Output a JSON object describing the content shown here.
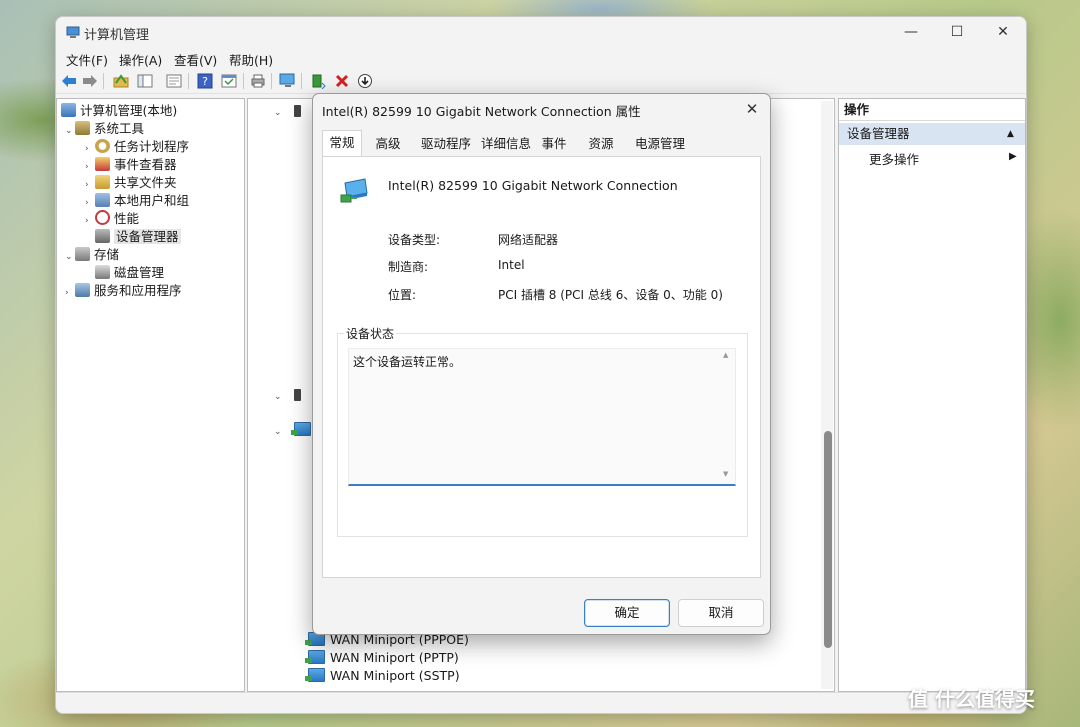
{
  "window": {
    "title": "计算机管理",
    "minimize": "—",
    "maximize": "☐",
    "close": "✕"
  },
  "menu": [
    "文件(F)",
    "操作(A)",
    "查看(V)",
    "帮助(H)"
  ],
  "toolbar": {
    "icons": [
      "back-icon",
      "forward-icon",
      "up-folder-icon",
      "console-tree-icon",
      "export-icon",
      "help-icon",
      "properties-icon",
      "print-icon",
      "scan-hardware-icon",
      "update-driver-icon",
      "uninstall-icon",
      "disable-icon"
    ]
  },
  "tree": {
    "root": "计算机管理(本地)",
    "system_tools": "系统工具",
    "task_scheduler": "任务计划程序",
    "event_viewer": "事件查看器",
    "shared_folders": "共享文件夹",
    "local_users": "本地用户和组",
    "performance": "性能",
    "device_manager": "设备管理器",
    "storage": "存储",
    "disk_management": "磁盘管理",
    "services_apps": "服务和应用程序"
  },
  "devices": {
    "visible": [
      "WAN Miniport (PPPOE)",
      "WAN Miniport (PPTP)",
      "WAN Miniport (SSTP)"
    ]
  },
  "actions": {
    "header": "操作",
    "section": "设备管理器",
    "more": "更多操作"
  },
  "dialog": {
    "title": "Intel(R) 82599 10 Gigabit Network Connection 属性",
    "close": "✕",
    "tabs": [
      "常规",
      "高级",
      "驱动程序",
      "详细信息",
      "事件",
      "资源",
      "电源管理"
    ],
    "device_name": "Intel(R) 82599 10 Gigabit Network Connection",
    "device_type_label": "设备类型:",
    "device_type_value": "网络适配器",
    "manufacturer_label": "制造商:",
    "manufacturer_value": "Intel",
    "location_label": "位置:",
    "location_value": "PCI 插槽 8 (PCI 总线 6、设备 0、功能 0)",
    "status_group": "设备状态",
    "status_text": "这个设备运转正常。",
    "ok": "确定",
    "cancel": "取消"
  },
  "watermark": "值 什么值得买"
}
